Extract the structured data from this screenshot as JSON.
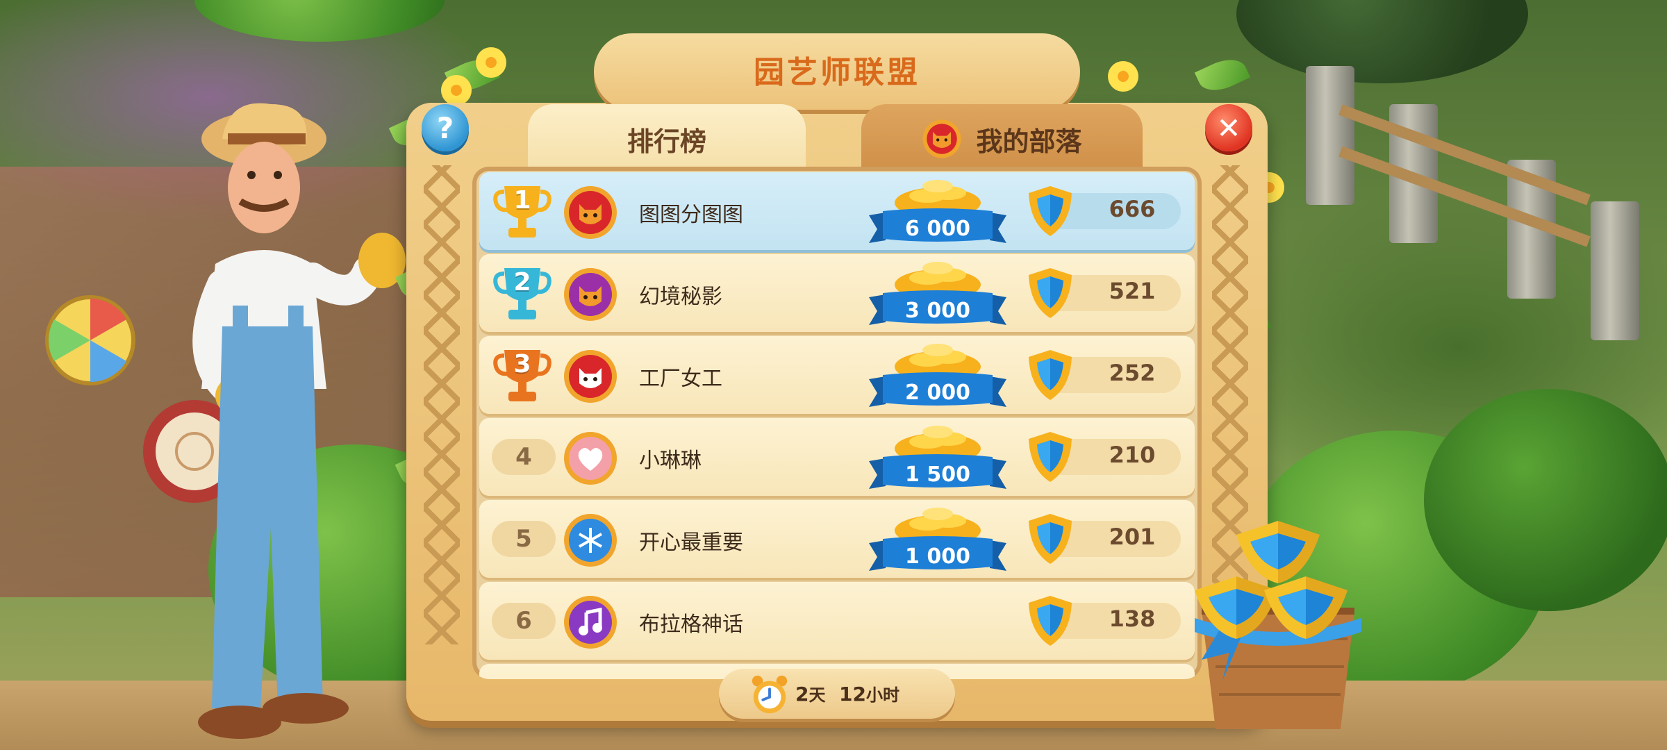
{
  "window": {
    "title": "园艺师联盟"
  },
  "tabs": [
    {
      "label": "排行榜",
      "active": true
    },
    {
      "label": "我的部落",
      "active": false
    }
  ],
  "buttons": {
    "help": "?",
    "close": "✕"
  },
  "leaderboard": [
    {
      "rank": "1",
      "name": "图图分图图",
      "reward": "6 000",
      "score": "666",
      "emblem": "tiger",
      "trophy": "gold"
    },
    {
      "rank": "2",
      "name": "幻境秘影",
      "reward": "3 000",
      "score": "521",
      "emblem": "dragon",
      "trophy": "silver"
    },
    {
      "rank": "3",
      "name": "工厂女工",
      "reward": "2 000",
      "score": "252",
      "emblem": "cat",
      "trophy": "bronze"
    },
    {
      "rank": "4",
      "name": "小琳琳",
      "reward": "1 500",
      "score": "210",
      "emblem": "heart",
      "trophy": "none"
    },
    {
      "rank": "5",
      "name": "开心最重要",
      "reward": "1 000",
      "score": "201",
      "emblem": "snowflake",
      "trophy": "none"
    },
    {
      "rank": "6",
      "name": "布拉格神话",
      "reward": "",
      "score": "138",
      "emblem": "music-note",
      "trophy": "none"
    }
  ],
  "timer": {
    "days_value": "2",
    "days_unit": "天",
    "hours_value": "12",
    "hours_unit": "小时"
  },
  "colors": {
    "title": "#d96a1c",
    "gold": "#f7b11c",
    "silver": "#37b7d8",
    "bronze": "#e9741f",
    "ribbon": "#1e7fd6",
    "close": "#e03422",
    "help": "#2f95d3"
  }
}
